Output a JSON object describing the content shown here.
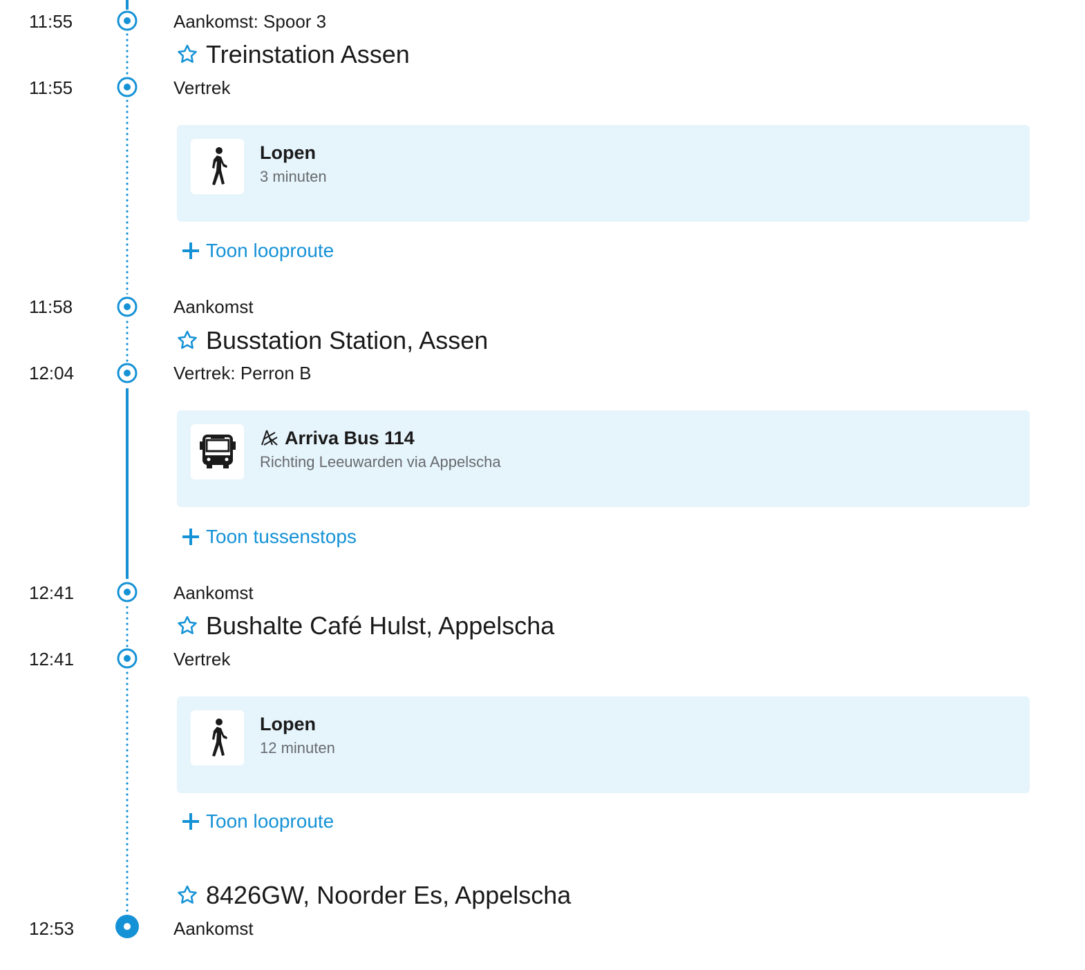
{
  "colors": {
    "accent": "#1592d6",
    "card_bg": "#e6f4fc",
    "text": "#1a1a1a",
    "muted": "#666a6e"
  },
  "itinerary": {
    "stop1": {
      "arrival_time": "11:55",
      "arrival_label": "Aankomst: Spoor 3",
      "name": "Treinstation Assen",
      "departure_time": "11:55",
      "departure_label": "Vertrek"
    },
    "leg1": {
      "mode_icon": "walk-icon",
      "title": "Lopen",
      "subtitle": "3 minuten",
      "toggle_label": "Toon looproute"
    },
    "stop2": {
      "arrival_time": "11:58",
      "arrival_label": "Aankomst",
      "name": "Busstation Station, Assen",
      "departure_time": "12:04",
      "departure_label": "Vertrek: Perron B"
    },
    "leg2": {
      "mode_icon": "bus-icon",
      "operator_icon": "arriva-logo-icon",
      "title": "Arriva Bus 114",
      "subtitle": "Richting Leeuwarden via Appelscha",
      "toggle_label": "Toon tussenstops"
    },
    "stop3": {
      "arrival_time": "12:41",
      "arrival_label": "Aankomst",
      "name": "Bushalte Café Hulst, Appelscha",
      "departure_time": "12:41",
      "departure_label": "Vertrek"
    },
    "leg3": {
      "mode_icon": "walk-icon",
      "title": "Lopen",
      "subtitle": "12 minuten",
      "toggle_label": "Toon looproute"
    },
    "destination": {
      "name": "8426GW, Noorder Es, Appelscha",
      "arrival_time": "12:53",
      "arrival_label": "Aankomst"
    }
  }
}
